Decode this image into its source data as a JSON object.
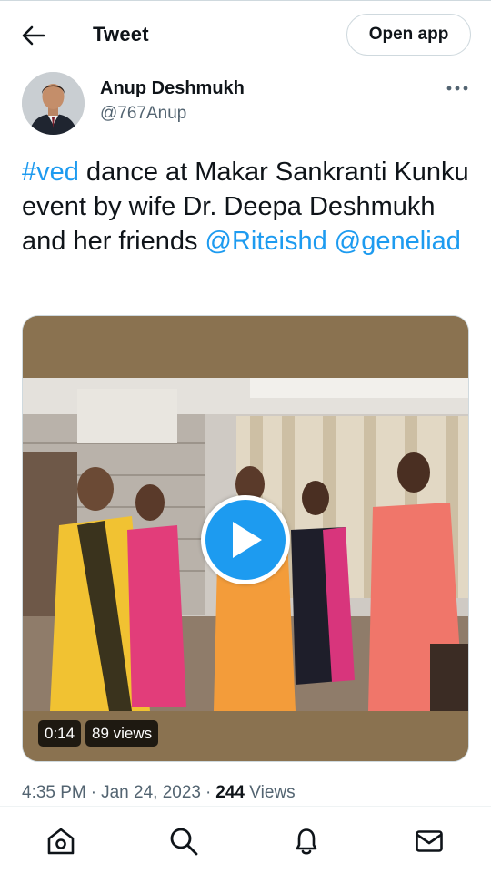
{
  "topbar": {
    "title": "Tweet",
    "open_app_label": "Open app",
    "back_icon": "arrow-left-icon"
  },
  "author": {
    "name": "Anup Deshmukh",
    "handle": "@767Anup",
    "more_icon": "more-horizontal-icon"
  },
  "tweet": {
    "hashtag": "#ved",
    "text": " dance at Makar Sankranti Kunku event by wife Dr. Deepa Deshmukh and her friends ",
    "mention1": "@Riteishd",
    "mention2": "@geneliad"
  },
  "media": {
    "duration": "0:14",
    "views": "89 views",
    "play_icon": "play-icon"
  },
  "meta": {
    "time": "4:35 PM",
    "separator": "·",
    "date": "Jan 24, 2023",
    "views_count": "244",
    "views_label": "Views"
  },
  "nav": {
    "items": [
      "home-icon",
      "search-icon",
      "notifications-icon",
      "messages-icon"
    ]
  },
  "colors": {
    "accent": "#1d9bf0",
    "text_primary": "#0f1419",
    "text_secondary": "#536471",
    "border": "#cfd9de"
  }
}
